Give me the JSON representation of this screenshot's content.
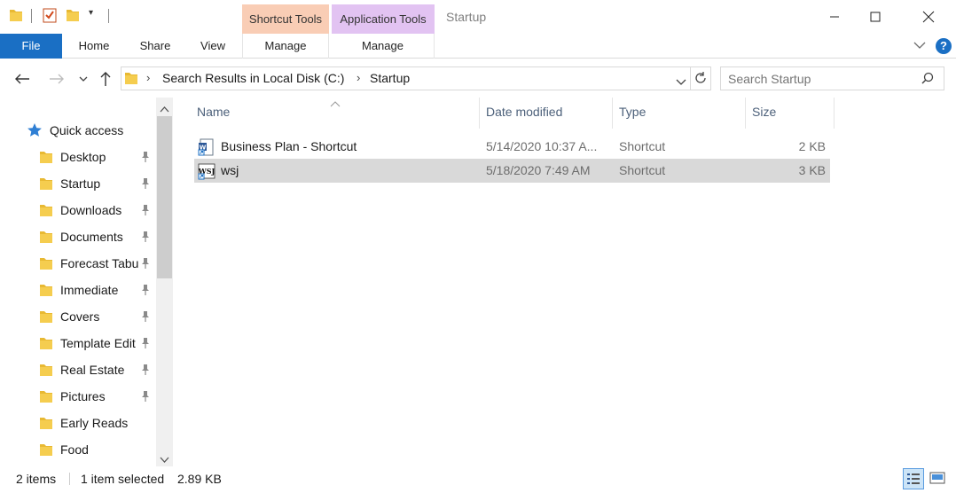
{
  "titlebar": {
    "window_title": "Startup",
    "context_tabs": {
      "shortcut_tools": "Shortcut Tools",
      "application_tools": "Application Tools"
    }
  },
  "ribbon": {
    "tabs": [
      "File",
      "Home",
      "Share",
      "View"
    ],
    "manage_labels": [
      "Manage",
      "Manage"
    ]
  },
  "address": {
    "breadcrumbs": [
      "Search Results in Local Disk (C:)",
      "Startup"
    ],
    "search_placeholder": "Search Startup"
  },
  "nav": {
    "quick_access": "Quick access",
    "items": [
      {
        "label": "Desktop",
        "pinned": true
      },
      {
        "label": "Startup",
        "pinned": true
      },
      {
        "label": "Downloads",
        "pinned": true
      },
      {
        "label": "Documents",
        "pinned": true
      },
      {
        "label": "Forecast Tabu",
        "pinned": true
      },
      {
        "label": "Immediate",
        "pinned": true
      },
      {
        "label": "Covers",
        "pinned": true
      },
      {
        "label": "Template Edit",
        "pinned": true
      },
      {
        "label": "Real Estate",
        "pinned": true
      },
      {
        "label": "Pictures",
        "pinned": true
      },
      {
        "label": "Early Reads",
        "pinned": false
      },
      {
        "label": "Food",
        "pinned": false
      }
    ]
  },
  "columns": {
    "name": "Name",
    "date": "Date modified",
    "type": "Type",
    "size": "Size"
  },
  "files": [
    {
      "name": "Business Plan - Shortcut",
      "date": "5/14/2020 10:37 A...",
      "type": "Shortcut",
      "size": "2 KB",
      "selected": false
    },
    {
      "name": "wsj",
      "date": "5/18/2020 7:49 AM",
      "type": "Shortcut",
      "size": "3 KB",
      "selected": true
    }
  ],
  "status": {
    "items": "2 items",
    "selected": "1 item selected",
    "size": "2.89 KB"
  },
  "colors": {
    "accent": "#1a6fc4",
    "shortcut_tools": "#f9cdb5",
    "application_tools": "#e2c3f2",
    "selection": "#d9d9d9",
    "folder": "#e8b933"
  }
}
